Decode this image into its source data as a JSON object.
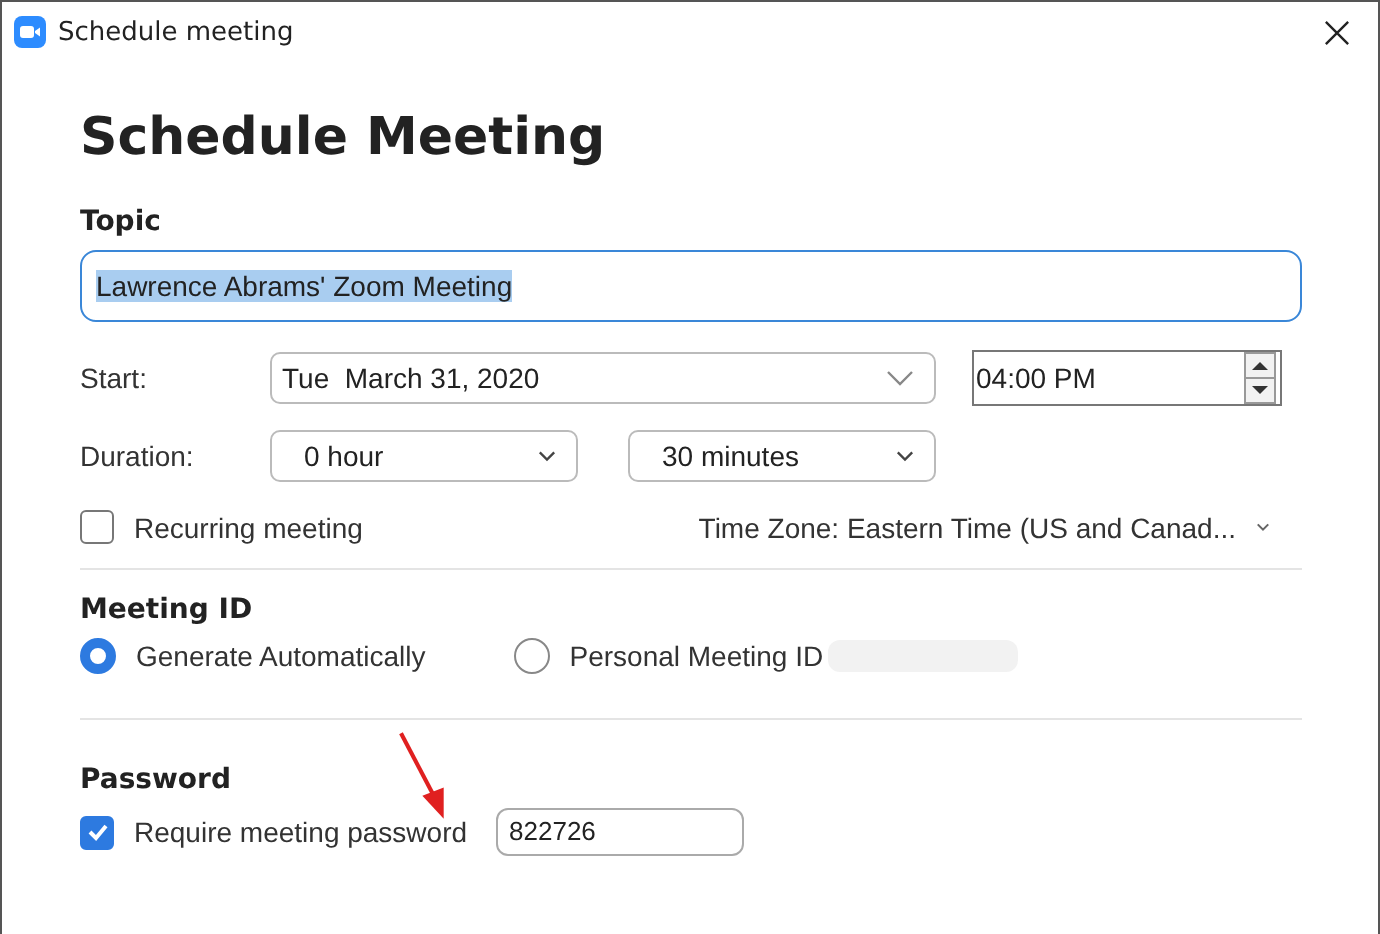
{
  "window": {
    "title": "Schedule meeting"
  },
  "heading": "Schedule Meeting",
  "topic": {
    "label": "Topic",
    "value": "Lawrence Abrams' Zoom Meeting",
    "text_selected": true
  },
  "start": {
    "label": "Start:",
    "date": "Tue  March 31, 2020",
    "time": "04:00 PM"
  },
  "duration": {
    "label": "Duration:",
    "hours": "0 hour",
    "minutes": "30 minutes"
  },
  "recurring": {
    "label": "Recurring meeting",
    "checked": false
  },
  "time_zone": "Time Zone: Eastern Time (US and Canad...",
  "meeting_id": {
    "title": "Meeting ID",
    "options": [
      {
        "label": "Generate Automatically",
        "selected": true
      },
      {
        "label": "Personal Meeting ID",
        "selected": false
      }
    ]
  },
  "password": {
    "title": "Password",
    "require": {
      "label": "Require meeting password",
      "checked": true
    },
    "value": "822726"
  }
}
